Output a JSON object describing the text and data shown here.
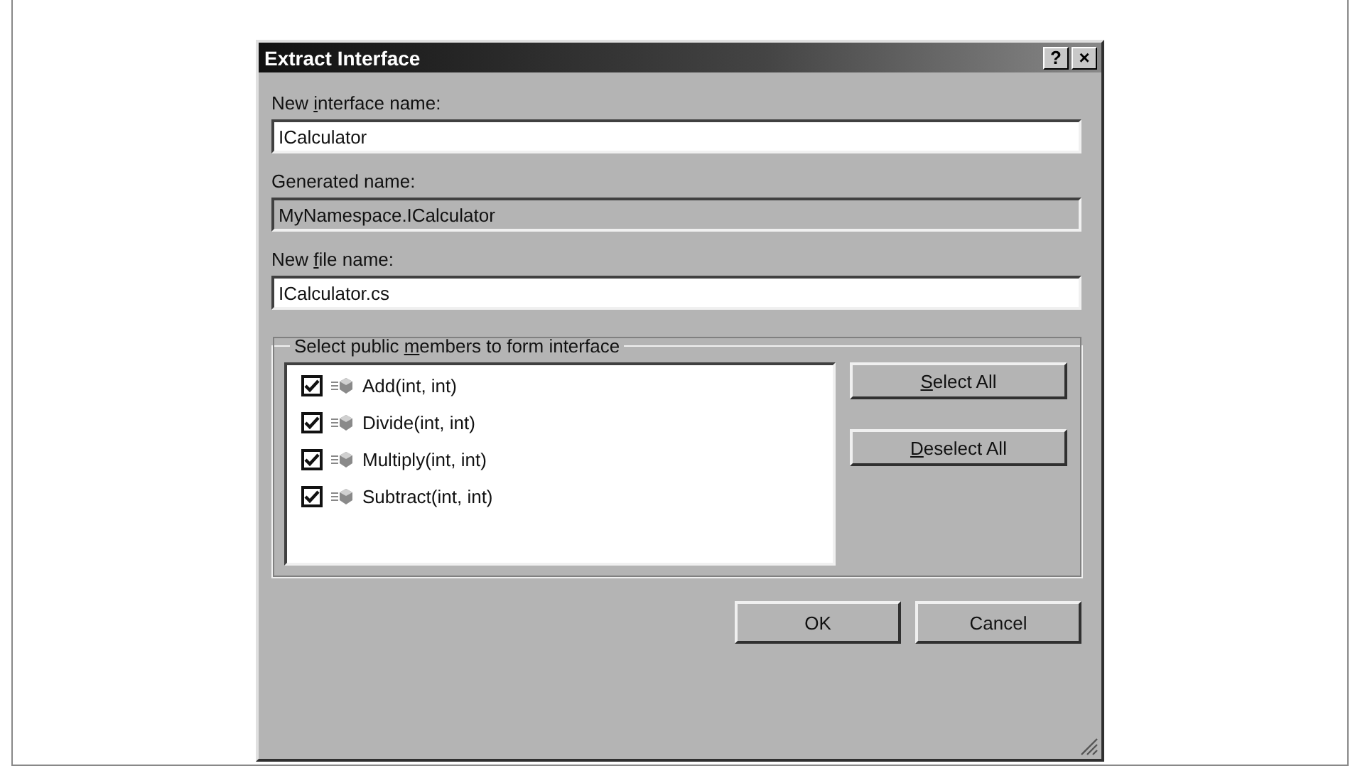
{
  "window": {
    "title": "Extract Interface",
    "title_buttons": [
      "?",
      "×"
    ]
  },
  "fields": [
    {
      "label_parts": [
        {
          "text": "New ",
          "underline": false
        },
        {
          "text": "i",
          "underline": true
        },
        {
          "text": "nterface name:",
          "underline": false
        }
      ],
      "value": "ICalculator",
      "disabled": false
    },
    {
      "label_parts": [
        {
          "text": "Generated name:",
          "underline": false
        }
      ],
      "value": "MyNamespace.ICalculator",
      "disabled": true
    },
    {
      "label_parts": [
        {
          "text": "New ",
          "underline": false
        },
        {
          "text": "f",
          "underline": true
        },
        {
          "text": "ile name:",
          "underline": false
        }
      ],
      "value": "ICalculator.cs",
      "disabled": false
    }
  ],
  "members_group": {
    "label_parts": [
      {
        "text": "Select public ",
        "underline": false
      },
      {
        "text": "m",
        "underline": true
      },
      {
        "text": "embers to form interface",
        "underline": false
      }
    ],
    "members": [
      {
        "name": "Add(int, int)",
        "checked": true
      },
      {
        "name": "Divide(int, int)",
        "checked": true
      },
      {
        "name": "Multiply(int, int)",
        "checked": true
      },
      {
        "name": "Subtract(int, int)",
        "checked": true
      }
    ],
    "buttons": [
      {
        "label_parts": [
          {
            "text": "S",
            "underline": true
          },
          {
            "text": "elect All",
            "underline": false
          }
        ]
      },
      {
        "label_parts": [
          {
            "text": "D",
            "underline": true
          },
          {
            "text": "eselect All",
            "underline": false
          }
        ]
      }
    ]
  },
  "buttons": [
    {
      "label_parts": [
        {
          "text": "OK",
          "underline": false
        }
      ]
    },
    {
      "label_parts": [
        {
          "text": "Cancel",
          "underline": false
        }
      ]
    }
  ]
}
